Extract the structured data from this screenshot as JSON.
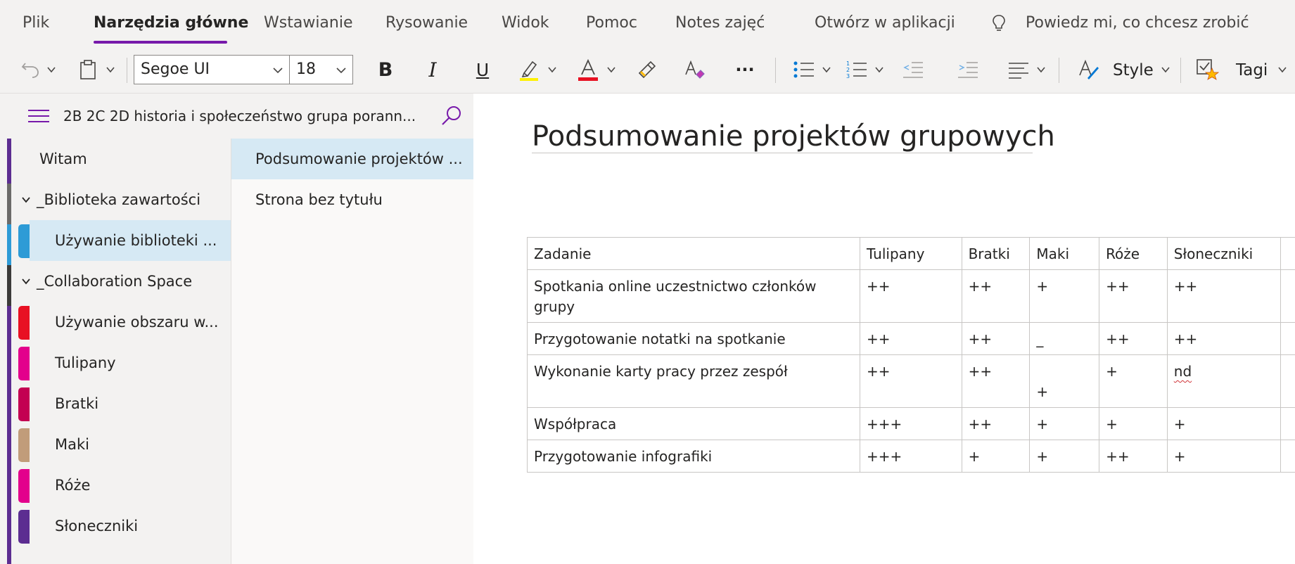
{
  "ribbon": {
    "tabs": [
      "Plik",
      "Narzędzia główne",
      "Wstawianie",
      "Rysowanie",
      "Widok",
      "Pomoc",
      "Notes zajęć",
      "Otwórz w aplikacji"
    ],
    "active_tab": "Narzędzia główne",
    "tell_me": "Powiedz mi, co chcesz zrobić",
    "font_name": "Segoe UI",
    "font_size": "18",
    "bold": "B",
    "italic": "I",
    "underline": "U",
    "more": "···",
    "styles_label": "Style",
    "tags_label": "Tagi",
    "highlight_color": "#fff100",
    "font_color": "#e81123"
  },
  "notebook": {
    "title": "2B 2C 2D historia i społeczeństwo grupa porann...",
    "sections": [
      {
        "label": "Witam",
        "color": "#5c2d91"
      },
      {
        "label": "_Biblioteka zawartości",
        "group": true
      },
      {
        "label": "Używanie biblioteki ...",
        "color": "#2e9bd6",
        "selected": true
      },
      {
        "label": "_Collaboration Space",
        "group": true
      },
      {
        "label": "Używanie obszaru w...",
        "color": "#e3008c"
      },
      {
        "label": "Tulipany",
        "color": "#e3008c"
      },
      {
        "label": "Bratki",
        "color": "#c30052"
      },
      {
        "label": "Maki",
        "color": "#c19c7a"
      },
      {
        "label": "Róże",
        "color": "#e3008c"
      },
      {
        "label": "Słoneczniki",
        "color": "#5c2d91"
      }
    ],
    "pages": [
      {
        "label": "Podsumowanie projektów ...",
        "selected": true
      },
      {
        "label": "Strona bez tytułu"
      }
    ]
  },
  "page": {
    "title": "Podsumowanie projektów grupowych",
    "table": {
      "headers": [
        "Zadanie",
        "Tulipany",
        "Bratki",
        "Maki",
        "Róże",
        "Słoneczniki"
      ],
      "rows": [
        [
          "Spotkania online uczestnictwo członków grupy",
          "++",
          "++",
          "+",
          "++",
          "++"
        ],
        [
          "Przygotowanie notatki na spotkanie",
          "++",
          "++",
          "_",
          "++",
          "++"
        ],
        [
          "Wykonanie karty pracy przez zespół",
          "++",
          "++",
          "+",
          "+",
          "nd"
        ],
        [
          "Współpraca",
          "+++",
          "++",
          "+",
          "+",
          "+"
        ],
        [
          "Przygotowanie infografiki",
          "+++",
          "+",
          "+",
          "++",
          "+"
        ]
      ]
    }
  }
}
